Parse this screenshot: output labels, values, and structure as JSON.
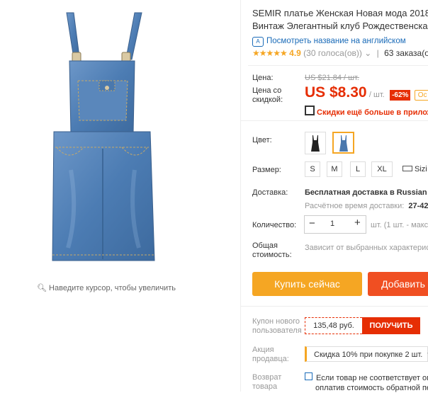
{
  "product": {
    "zoom_hint": "Наведите курсор, чтобы увеличить",
    "title_line1": "SEMIR платье Женская Новая мода 2018",
    "title_line2": "Винтаж Элегантный клуб Рождественска",
    "translate_link": "Посмотреть название на английском",
    "stars": "★★★★★",
    "rating": "4.9",
    "votes": "(30 голоса(ов))",
    "orders": "63 заказа(ов)"
  },
  "price": {
    "label_price": "Цена:",
    "old_price": "US $21.84 / шт.",
    "label_discount_1": "Цена со",
    "label_discount_2": "скидкой:",
    "new_price": "US $8.30",
    "unit": "/ шт.",
    "discount_badge": "-62%",
    "extra_badge": "Ос",
    "app_promo": "Скидки ещё больше в приложен"
  },
  "options": {
    "color_label": "Цвет:",
    "size_label": "Размер:",
    "sizes": [
      "S",
      "M",
      "L",
      "XL"
    ],
    "size_chart": "Sizi",
    "delivery_label": "Доставка:",
    "delivery_value": "Бесплатная доставка в Russian Fe",
    "delivery_time_label": "Расчётное время доставки:",
    "delivery_time_value": "27-42 ,",
    "qty_label": "Количество:",
    "qty_value": "1",
    "qty_note": "шт. (1 шт. - макс",
    "total_label_1": "Общая",
    "total_label_2": "стоимость:",
    "total_value": "Зависит от выбранных характерис"
  },
  "actions": {
    "buy_now": "Купить сейчас",
    "add_to_cart": "Добавить"
  },
  "promos": {
    "coupon_label_1": "Купон нового",
    "coupon_label_2": "пользователя",
    "coupon_value": "135,48 руб.",
    "coupon_button": "ПОЛУЧИТЬ",
    "seller_label_1": "Акция",
    "seller_label_2": "продавца:",
    "seller_value": "Скидка 10% при покупке 2 шт.",
    "return_label_1": "Возврат",
    "return_label_2": "товара",
    "return_line1": "Если товар не соответствует опи",
    "return_line2": "оплатив стоимость обратной пе"
  },
  "colors": {
    "accent": "#f5a623",
    "price_red": "#e62e04",
    "link_blue": "#1a6bb8",
    "denim": "#4a78ad"
  }
}
